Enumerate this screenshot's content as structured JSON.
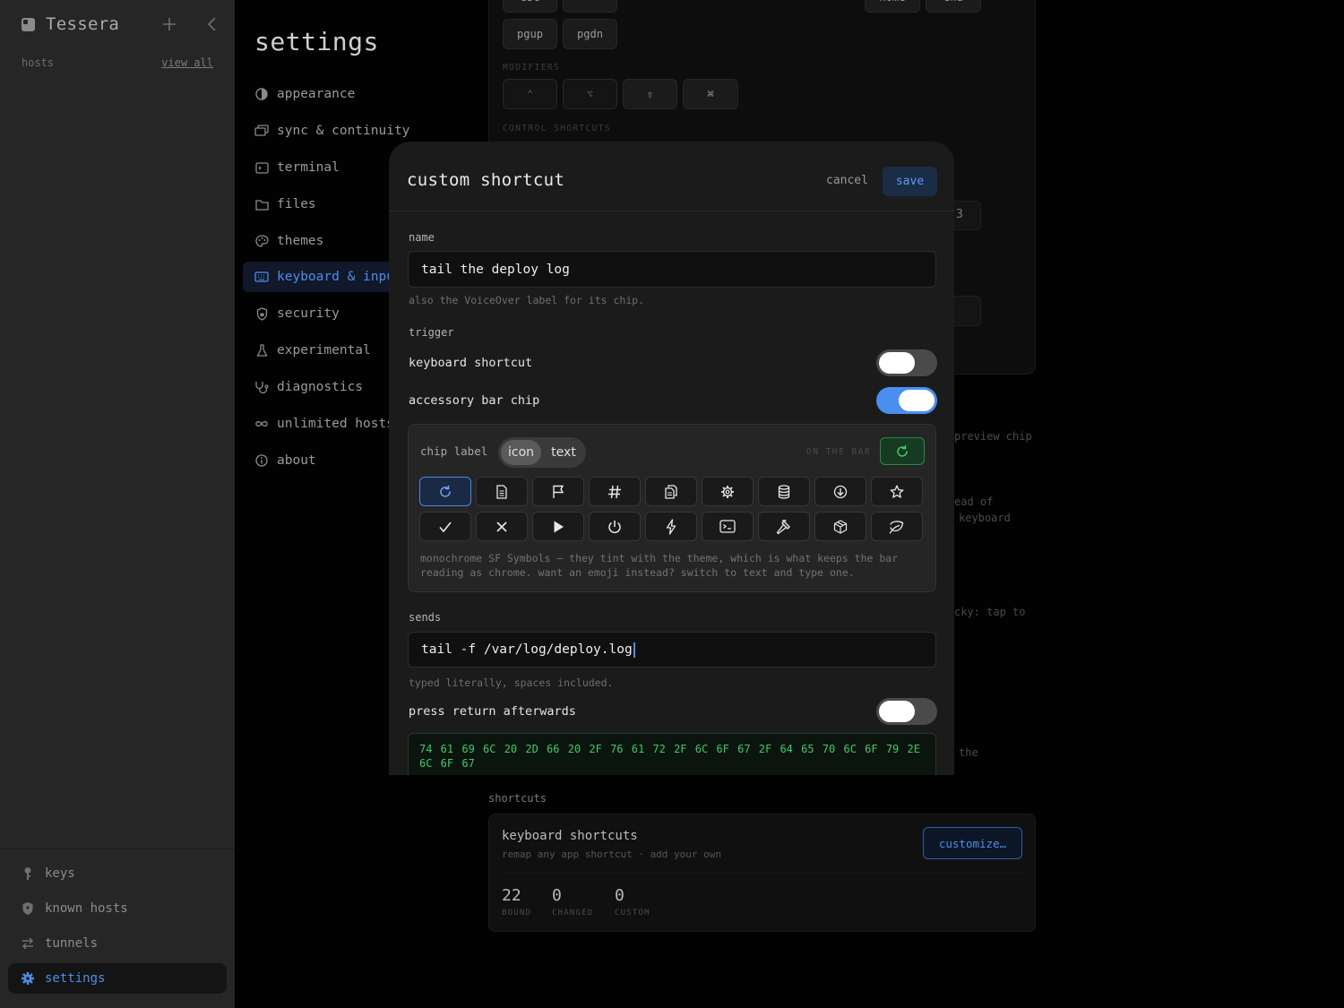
{
  "sidebar": {
    "app_title": "Tessera",
    "hosts_label": "hosts",
    "view_all": "view all",
    "bottom_items": [
      {
        "label": "keys",
        "icon": "key-icon"
      },
      {
        "label": "known hosts",
        "icon": "shield-icon"
      },
      {
        "label": "tunnels",
        "icon": "arrows-icon"
      },
      {
        "label": "settings",
        "icon": "gear-icon",
        "active": true
      }
    ]
  },
  "settings": {
    "title": "settings",
    "nav": [
      {
        "label": "appearance",
        "icon": "contrast-icon"
      },
      {
        "label": "sync & continuity",
        "icon": "sync-icon"
      },
      {
        "label": "terminal",
        "icon": "terminal-icon"
      },
      {
        "label": "files",
        "icon": "folder-icon"
      },
      {
        "label": "themes",
        "icon": "palette-icon"
      },
      {
        "label": "keyboard & input",
        "icon": "keyboard-icon",
        "active": true
      },
      {
        "label": "security",
        "icon": "lock-shield-icon"
      },
      {
        "label": "experimental",
        "icon": "flask-icon"
      },
      {
        "label": "diagnostics",
        "icon": "stethoscope-icon"
      },
      {
        "label": "unlimited hosts",
        "icon": "infinity-icon"
      },
      {
        "label": "about",
        "icon": "info-icon"
      }
    ]
  },
  "background": {
    "keys_row1": [
      "esc",
      "⇥",
      "←",
      "↓",
      "↑",
      "→",
      "home",
      "end"
    ],
    "keys_row2": [
      "pgup",
      "pgdn"
    ],
    "modifiers_label": "MODIFIERS",
    "modifiers": [
      "⌃",
      "⌥",
      "⇧",
      "⌘"
    ],
    "control_label": "CONTROL SHORTCUTS",
    "right_value": "3",
    "right_texts": [
      "preview chip",
      "ead of",
      "keyboard",
      "cky: tap to",
      "the"
    ],
    "shortcuts_label": "shortcuts",
    "card": {
      "title": "keyboard shortcuts",
      "subtitle": "remap any app shortcut · add your own",
      "button": "customize…",
      "stats": [
        {
          "num": "22",
          "label": "BOUND"
        },
        {
          "num": "0",
          "label": "CHANGED"
        },
        {
          "num": "0",
          "label": "CUSTOM"
        }
      ]
    }
  },
  "modal": {
    "title": "custom shortcut",
    "cancel": "cancel",
    "save": "save",
    "name_label": "name",
    "name_value": "tail the deploy log",
    "name_hint": "also the VoiceOver label for its chip.",
    "trigger_label": "trigger",
    "keyboard_shortcut_label": "keyboard shortcut",
    "keyboard_shortcut_on": false,
    "accessory_chip_label": "accessory bar chip",
    "accessory_chip_on": true,
    "chip_label": "chip label",
    "seg_icon": "icon",
    "seg_text": "text",
    "on_the_bar": "ON THE BAR",
    "icons": [
      "refresh-icon",
      "document-icon",
      "flag-icon",
      "hash-icon",
      "copy-icon",
      "gear-icon",
      "database-icon",
      "download-icon",
      "star-icon",
      "checkmark-icon",
      "close-icon",
      "play-icon",
      "power-icon",
      "bolt-icon",
      "terminal-icon",
      "hammer-icon",
      "box-icon",
      "leaf-icon"
    ],
    "selected_icon": "refresh-icon",
    "chip_hint": "monochrome SF Symbols — they tint with the theme, which is what keeps the bar reading as chrome. want an emoji instead? switch to text and type one.",
    "sends_label": "sends",
    "sends_value": "tail -f /var/log/deploy.log",
    "sends_hint": "typed literally, spaces included.",
    "press_return_label": "press return afterwards",
    "press_return_on": false,
    "bytes": "74 61 69 6C 20 2D 66 20 2F 76 61 72 2F 6C 6F 67 2F 64 65 70 6C 6F 79 2E 6C 6F 67"
  },
  "colors": {
    "accent": "#4d8ee8",
    "toggle_on": "#4a8ff0",
    "hex_green": "#3ec96a"
  }
}
